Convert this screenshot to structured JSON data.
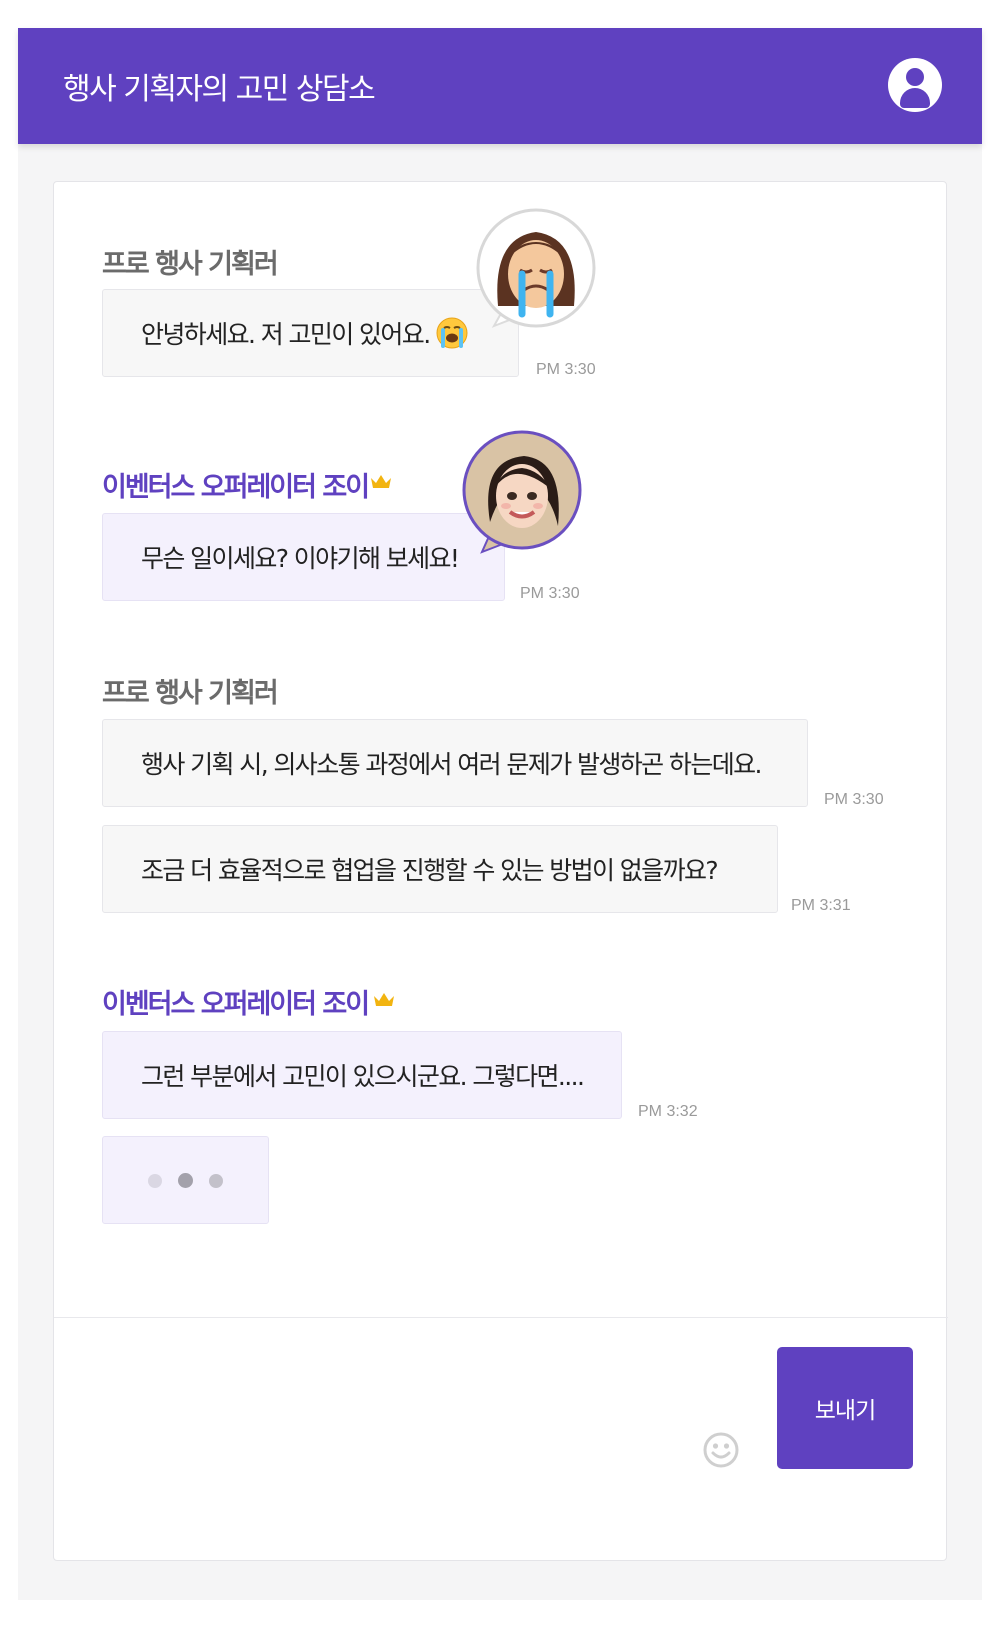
{
  "header": {
    "title": "행사 기획자의 고민 상담소",
    "user_icon": "user-icon"
  },
  "messages": [
    {
      "sender": "프로 행사 기획러",
      "role": "planner",
      "avatar": "crying-woman-emoji-avatar",
      "lines": [
        {
          "text": "안녕하세요.  저 고민이 있어요.",
          "emoji": "loudly-crying-face",
          "time": "PM 3:30"
        }
      ]
    },
    {
      "sender": "이벤터스 오퍼레이터 조이",
      "role": "operator",
      "badge": "crown-icon",
      "avatar": "operator-memoji-avatar",
      "lines": [
        {
          "text": "무슨 일이세요? 이야기해 보세요!",
          "time": "PM 3:30"
        }
      ]
    },
    {
      "sender": "프로 행사 기획러",
      "role": "planner",
      "lines": [
        {
          "text": "행사 기획 시, 의사소통 과정에서 여러 문제가 발생하곤 하는데요.",
          "time": "PM 3:30"
        },
        {
          "text": "조금 더 효율적으로 협업을 진행할 수 있는 방법이 없을까요?",
          "time": "PM 3:31"
        }
      ]
    },
    {
      "sender": "이벤터스 오퍼레이터 조이",
      "role": "operator",
      "badge": "crown-icon",
      "lines": [
        {
          "text": "그런 부분에서 고민이 있으시군요. 그렇다면....",
          "time": "PM 3:32"
        }
      ],
      "typing": true
    }
  ],
  "composer": {
    "input_value": "",
    "send_label": "보내기",
    "emoji_icon": "smiley-icon"
  },
  "colors": {
    "accent": "#5f41c0",
    "operator_bubble": "#f4f1fd",
    "planner_bubble": "#f7f7f7",
    "crown": "#f2b410"
  }
}
